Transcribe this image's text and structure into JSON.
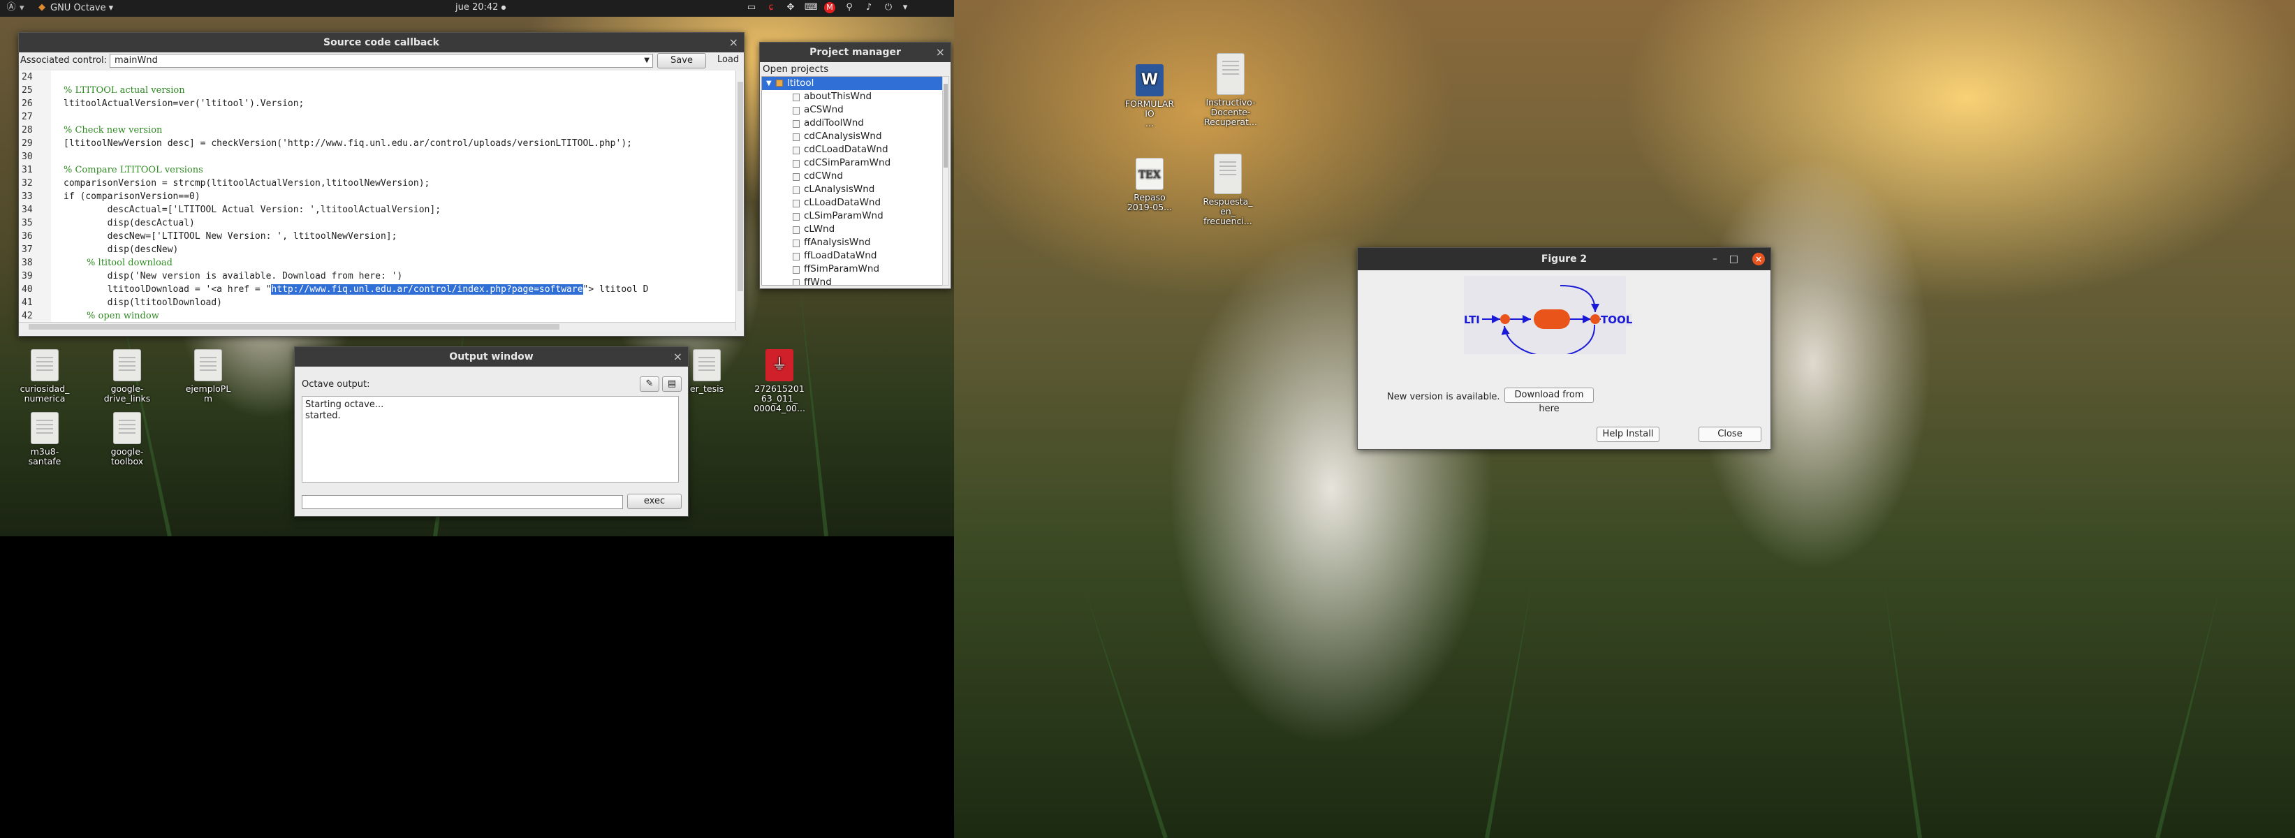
{
  "top_panel": {
    "app_menu": "GNU Octave",
    "clock": "jue 20:42"
  },
  "desktop_left": [
    {
      "label": "curiosidad_\nnumerica"
    },
    {
      "label": "google-\ndrive_links"
    },
    {
      "label": "ejemploPL\nm"
    },
    {
      "label": "m3u8-\nsantafe"
    },
    {
      "label": "google-\ntoolbox"
    },
    {
      "label": "er_tesis"
    },
    {
      "label": "272615201\n63_011_\n00004_00..."
    }
  ],
  "desktop_right": [
    {
      "label": "FORMULAR\nIO\n..."
    },
    {
      "label": "Instructivo-\nDocente-\nRecuperat..."
    },
    {
      "label": "Repaso\n2019-05..."
    },
    {
      "label": "Respuesta_\nen_\nfrecuenci..."
    }
  ],
  "code_window": {
    "title": "Source code callback",
    "assoc_label": "Associated control:",
    "assoc_value": "mainWnd",
    "save": "Save",
    "load": "Load",
    "lines": [
      {
        "n": "24",
        "t": ""
      },
      {
        "n": "25",
        "t": "% LTITOOL actual version"
      },
      {
        "n": "26",
        "t": "ltitoolActualVersion=ver('ltitool').Version;"
      },
      {
        "n": "27",
        "t": ""
      },
      {
        "n": "28",
        "t": "% Check new version"
      },
      {
        "n": "29",
        "t": "[ltitoolNewVersion desc] = checkVersion('http://www.fiq.unl.edu.ar/control/uploads/versionLTITOOL.php');"
      },
      {
        "n": "30",
        "t": ""
      },
      {
        "n": "31",
        "t": "% Compare LTITOOL versions"
      },
      {
        "n": "32",
        "t": "comparisonVersion = strcmp(ltitoolActualVersion,ltitoolNewVersion);"
      },
      {
        "n": "33",
        "t": "if (comparisonVersion==0)"
      },
      {
        "n": "34",
        "t": "        descActual=['LTITOOL Actual Version: ',ltitoolActualVersion];"
      },
      {
        "n": "35",
        "t": "        disp(descActual)"
      },
      {
        "n": "36",
        "t": "        descNew=['LTITOOL New Version: ', ltitoolNewVersion];"
      },
      {
        "n": "37",
        "t": "        disp(descNew)"
      },
      {
        "n": "38",
        "t": "        % ltitool download"
      },
      {
        "n": "39",
        "t": "        disp('New version is available. Download from here: ')"
      },
      {
        "n": "40",
        "t": "        ltitoolDownload = '<a href = \"http://www.fiq.unl.edu.ar/control/index.php?page=software\"> ltitool D"
      },
      {
        "n": "41",
        "t": "        disp(ltitoolDownload)"
      },
      {
        "n": "42",
        "t": "        % open window"
      }
    ]
  },
  "project_manager": {
    "title": "Project manager",
    "header": "Open projects",
    "root": "ltitool",
    "items": [
      "aboutThisWnd",
      "aCSWnd",
      "addiToolWnd",
      "cdCAnalysisWnd",
      "cdCLoadDataWnd",
      "cdCSimParamWnd",
      "cdCWnd",
      "cLAnalysisWnd",
      "cLLoadDataWnd",
      "cLSimParamWnd",
      "cLWnd",
      "ffAnalysisWnd",
      "ffLoadDataWnd",
      "ffSimParamWnd",
      "ffWnd"
    ]
  },
  "output_window": {
    "title": "Output window",
    "label": "Octave output:",
    "text": "Starting octave...\nstarted.",
    "exec": "exec",
    "input_value": ""
  },
  "figure": {
    "title": "Figure 2",
    "logo_left": "LTI",
    "logo_right": "TOOL",
    "message": "New version is available.",
    "download": "Download from here",
    "help_install": "Help Install",
    "close": "Close"
  },
  "colors": {
    "selection": "#2f6fd6",
    "comment": "#2e8b22",
    "string": "#a02fa0",
    "logo_blue": "#1a1ad6",
    "logo_orange": "#e8541a"
  }
}
